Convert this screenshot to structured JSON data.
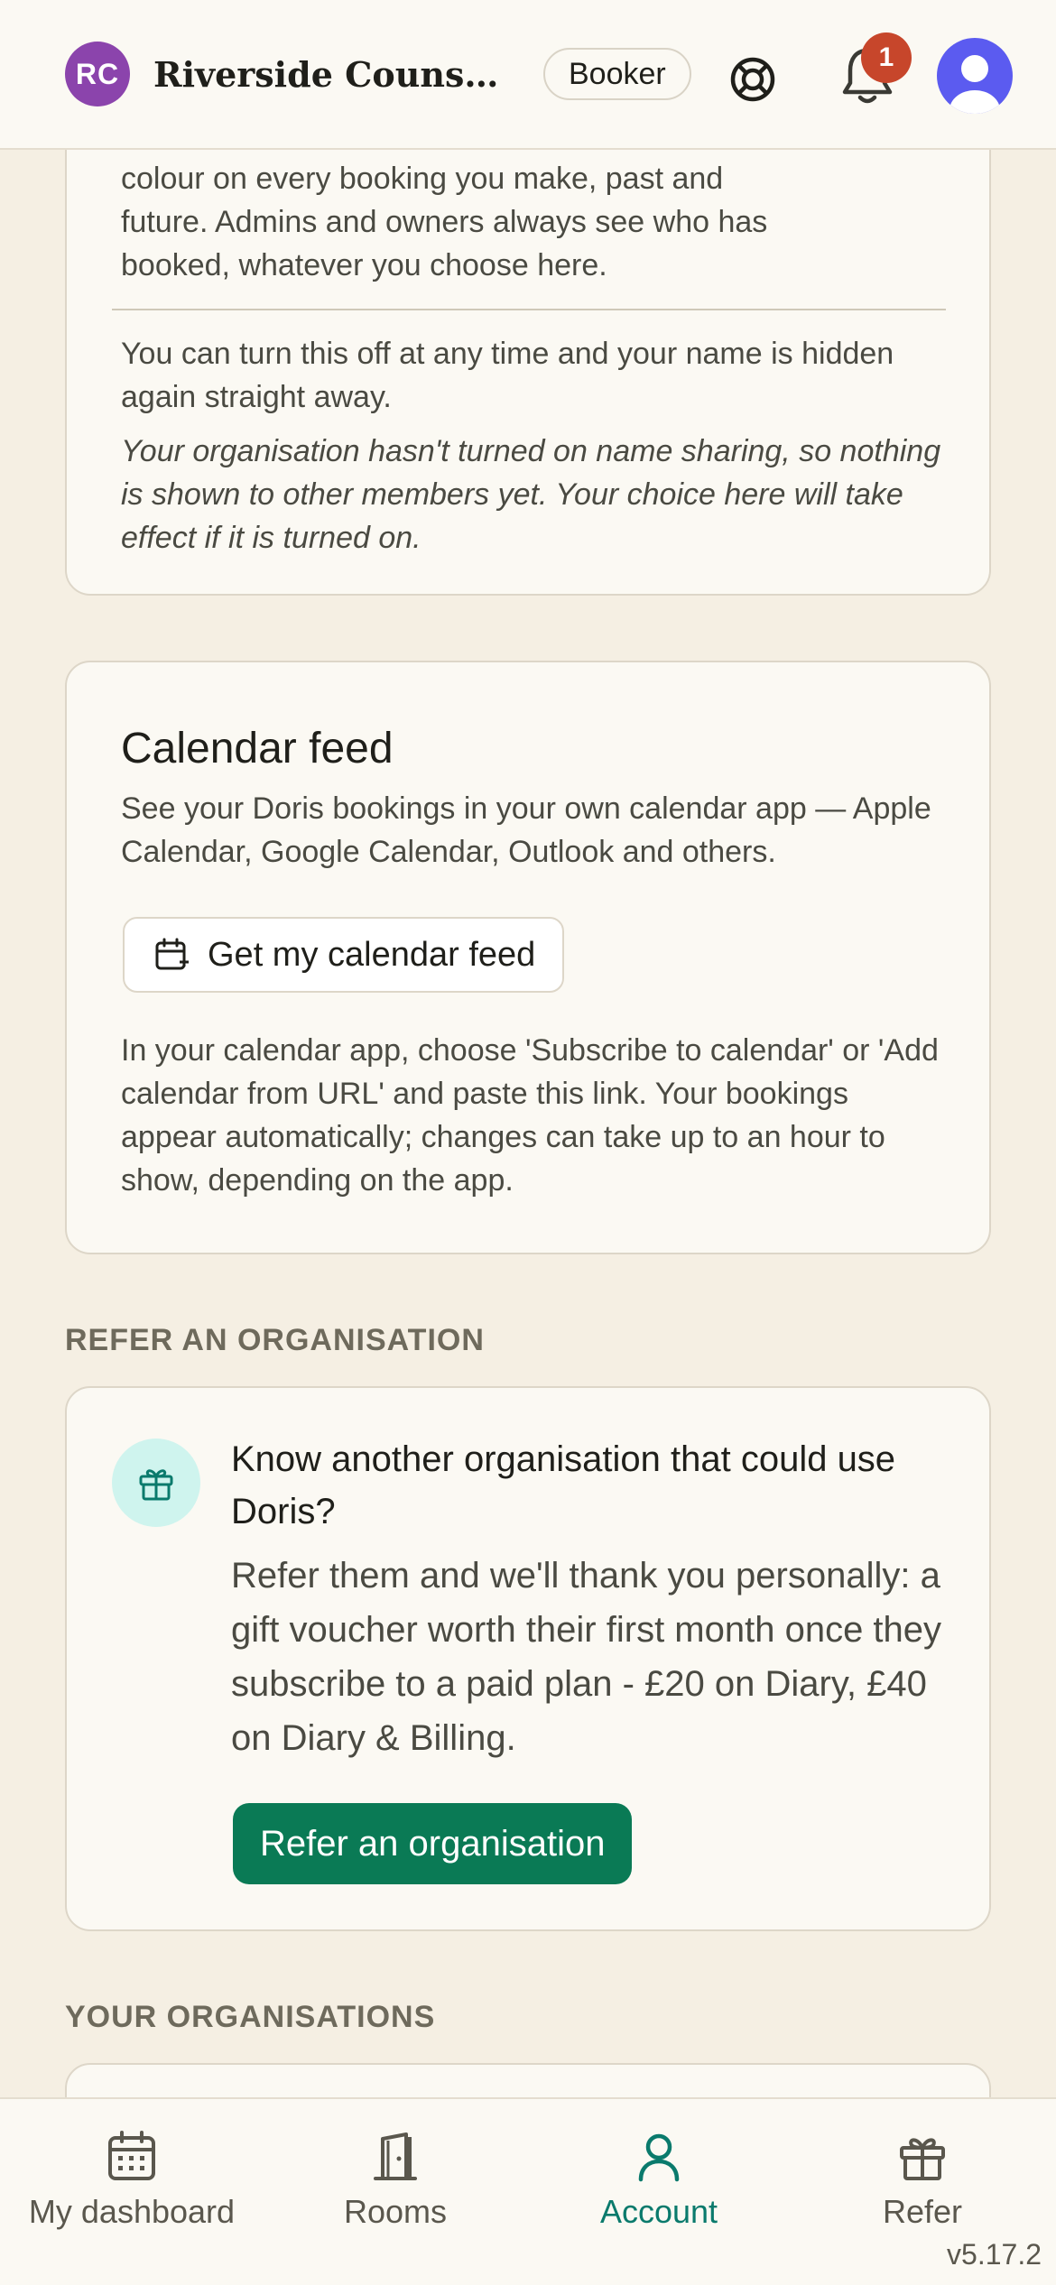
{
  "header": {
    "org_initials": "RC",
    "org_name": "Riverside Counse…",
    "role": "Booker",
    "notification_count": "1",
    "icons": {
      "help": "lifebuoy-icon",
      "notifications": "bell-icon",
      "user": "user-avatar-icon"
    }
  },
  "privacy_card": {
    "text_top": "colour on every booking you make, past and future. Admins and owners always see who has booked, whatever you choose here.",
    "text_off": "You can turn this off at any time and your name is hidden again straight away.",
    "text_note": "Your organisation hasn't turned on name sharing, so nothing is shown to other members yet. Your choice here will take effect if it is turned on."
  },
  "calendar_card": {
    "title": "Calendar feed",
    "description": "See your Doris bookings in your own calendar app — Apple Calendar, Google Calendar, Outlook and others.",
    "button_label": "Get my calendar feed",
    "instructions": "In your calendar app, choose 'Subscribe to calendar' or 'Add calendar from URL' and paste this link. Your bookings appear automatically; changes can take up to an hour to show, depending on the app."
  },
  "refer_section": {
    "label": "REFER AN ORGANISATION",
    "title": "Know another organisation that could use Doris?",
    "body": "Refer them and we'll thank you personally: a gift voucher worth their first month once they subscribe to a paid plan - £20 on Diary, £40 on Diary & Billing.",
    "button_label": "Refer an organisation"
  },
  "orgs_section": {
    "label": "YOUR ORGANISATIONS"
  },
  "bottom_nav": {
    "items": [
      {
        "label": "My dashboard",
        "icon": "calendar-icon"
      },
      {
        "label": "Rooms",
        "icon": "door-icon"
      },
      {
        "label": "Account",
        "icon": "user-icon",
        "active": true
      },
      {
        "label": "Refer",
        "icon": "gift-icon"
      }
    ]
  },
  "version": "v5.17.2",
  "colors": {
    "background": "#f5efe3",
    "card": "#fbf9f3",
    "accent_green": "#0a7a55",
    "active_teal": "#0a7a6c",
    "org_avatar": "#8b44ac",
    "badge": "#c7462b",
    "user_avatar": "#5b5bf0"
  }
}
